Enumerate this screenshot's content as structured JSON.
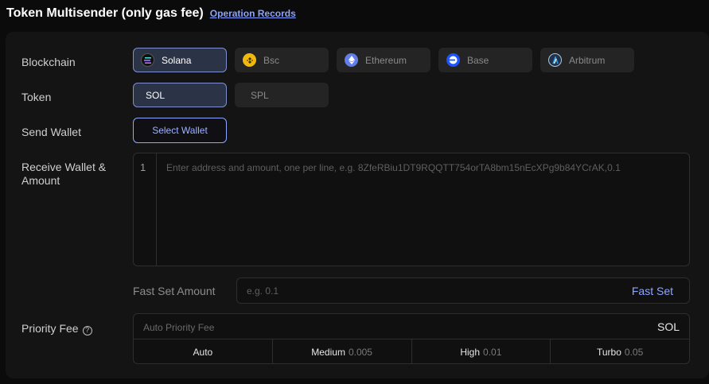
{
  "header": {
    "title": "Token Multisender (only gas fee)",
    "records_link": "Operation Records"
  },
  "labels": {
    "blockchain": "Blockchain",
    "token": "Token",
    "send_wallet": "Send Wallet",
    "receive_wallet_line1": "Receive Wallet &",
    "receive_wallet_line2": "Amount",
    "fast_set_amount": "Fast Set Amount",
    "priority_fee": "Priority Fee",
    "help_glyph": "?"
  },
  "blockchains": [
    {
      "label": "Solana",
      "icon": "solana-icon",
      "selected": true,
      "color": "#111111"
    },
    {
      "label": "Bsc",
      "icon": "bnb-icon",
      "selected": false,
      "color": "#f0b90b"
    },
    {
      "label": "Ethereum",
      "icon": "ethereum-icon",
      "selected": false,
      "color": "#627eea"
    },
    {
      "label": "Base",
      "icon": "base-icon",
      "selected": false,
      "color": "#1e54ff"
    },
    {
      "label": "Arbitrum",
      "icon": "arbitrum-icon",
      "selected": false,
      "color": "#213147"
    }
  ],
  "tokens": [
    {
      "label": "SOL",
      "selected": true
    },
    {
      "label": "SPL",
      "selected": false
    }
  ],
  "send_wallet": {
    "button_label": "Select Wallet"
  },
  "receive_editor": {
    "line_number": "1",
    "placeholder": "Enter address and amount, one per line, e.g. 8ZfeRBiu1DT9RQQTT754orTA8bm15nEcXPg9b84YCrAK,0.1"
  },
  "fast_set": {
    "placeholder": "e.g. 0.1",
    "button_label": "Fast Set"
  },
  "priority_fee": {
    "placeholder": "Auto Priority Fee",
    "unit": "SOL",
    "options": [
      {
        "label": "Auto",
        "value": ""
      },
      {
        "label": "Medium",
        "value": "0.005"
      },
      {
        "label": "High",
        "value": "0.01"
      },
      {
        "label": "Turbo",
        "value": "0.05"
      }
    ]
  },
  "colors": {
    "accent": "#8fa6ff",
    "selected_border": "#7e8fd0"
  }
}
